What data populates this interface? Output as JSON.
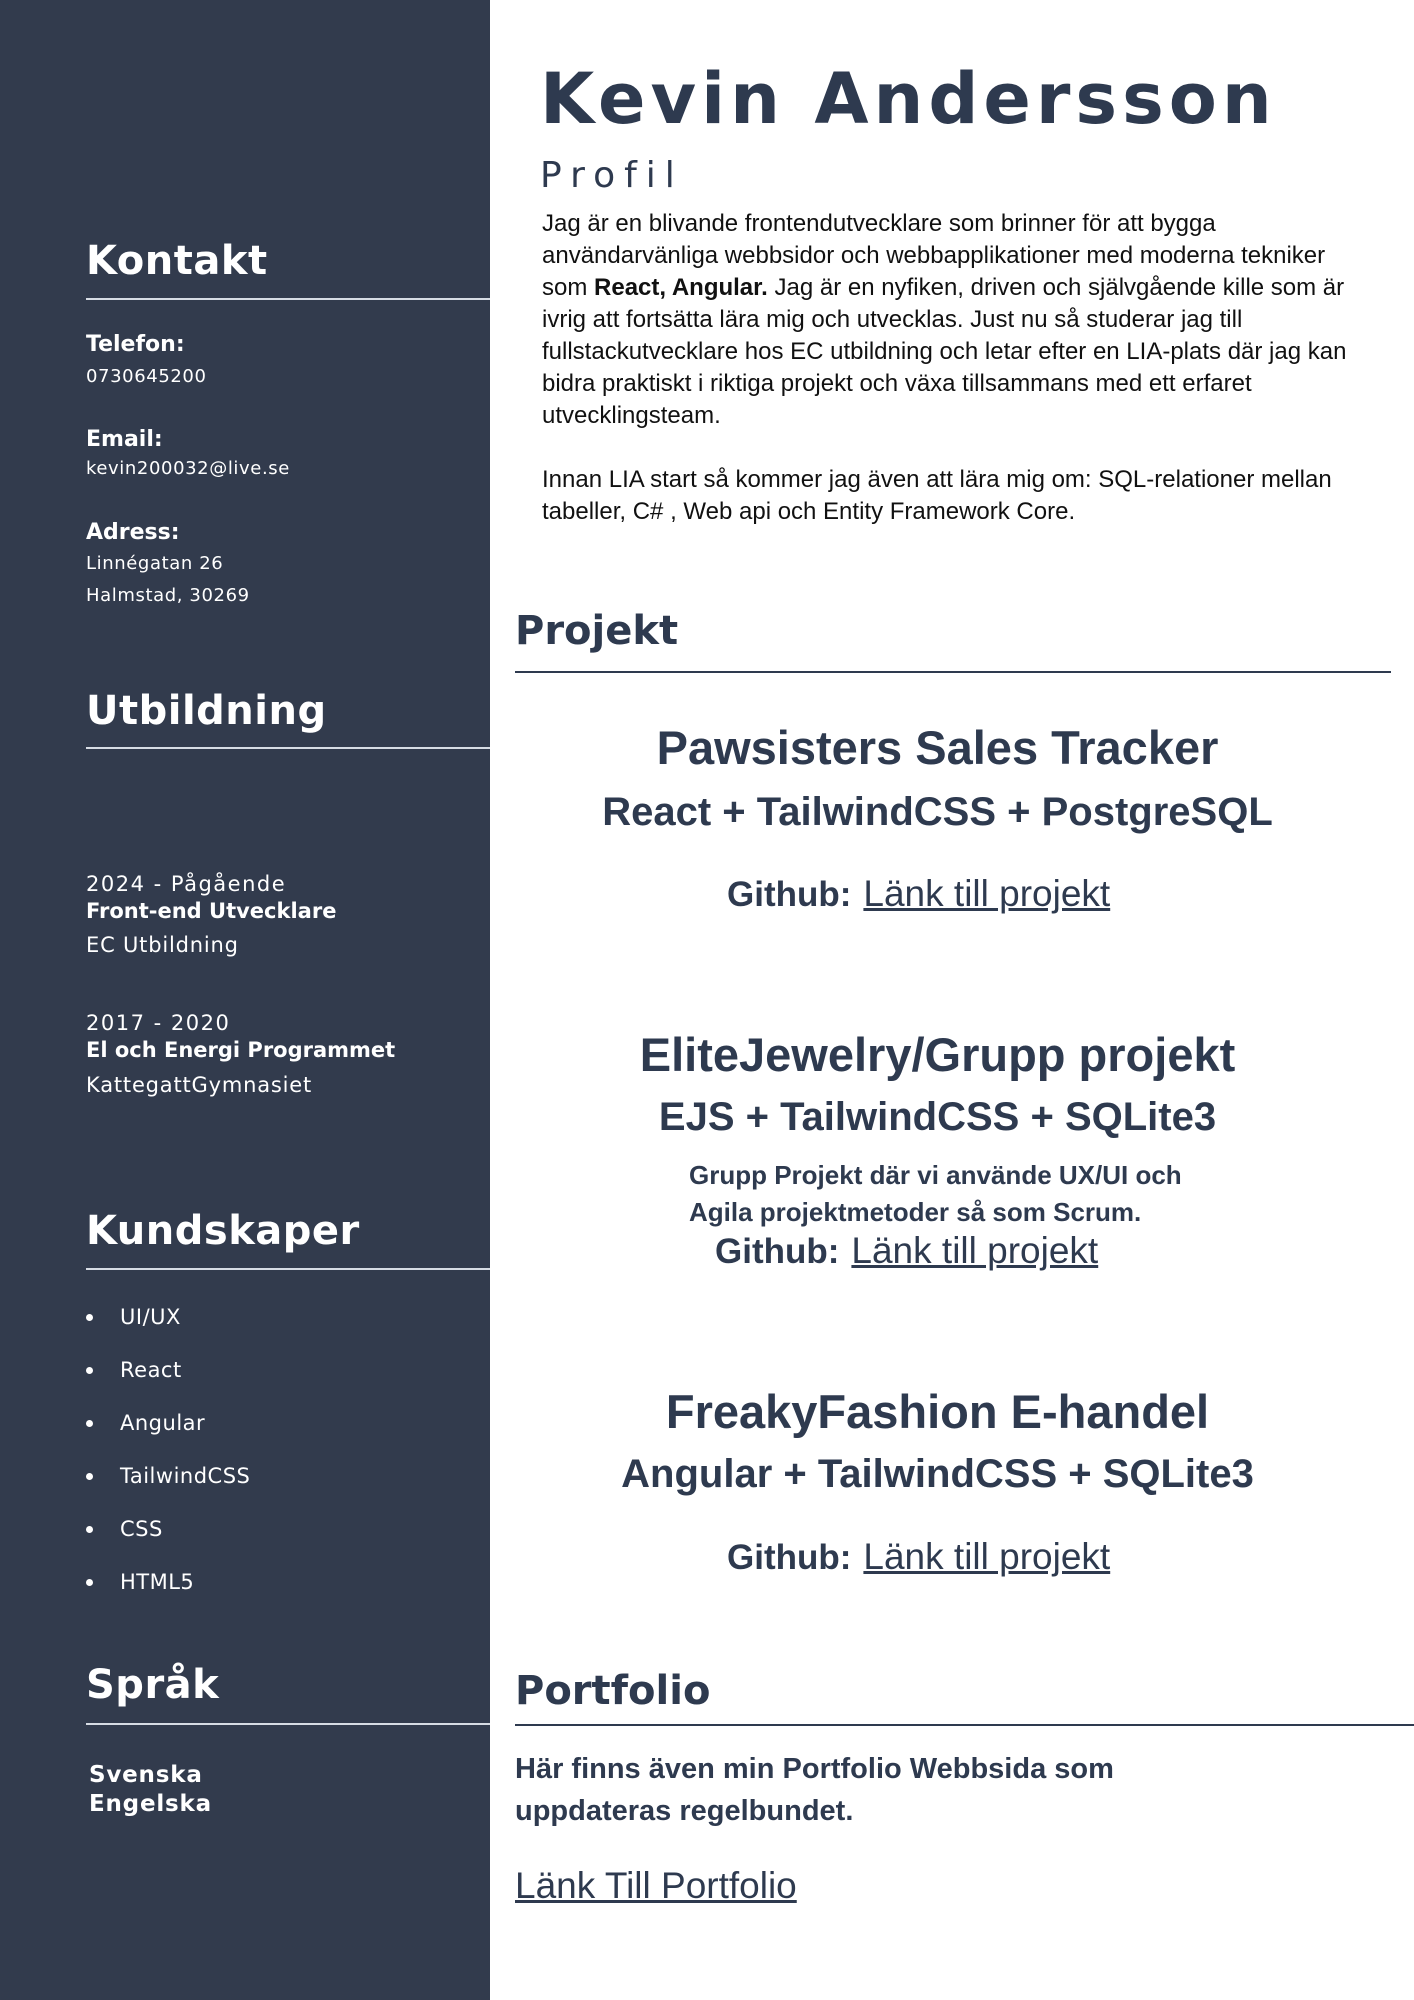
{
  "name": "Kevin Andersson",
  "profile": {
    "heading": "Profil",
    "p1_before": "Jag är en blivande frontendutvecklare som brinner för att bygga användarvänliga webbsidor och webbapplikationer med moderna tekniker som ",
    "p1_bold": "React, Angular.",
    "p1_after": " Jag är en nyfiken, driven och självgående kille som är ivrig att fortsätta lära mig och utvecklas. Just nu så studerar jag till fullstackutvecklare hos EC utbildning och letar efter en LIA-plats där jag kan bidra praktiskt i riktiga projekt och växa tillsammans med ett erfaret utvecklingsteam.",
    "p2": "Innan LIA start så kommer jag även att lära mig om: SQL-relationer mellan tabeller, C# , Web api och Entity Framework Core."
  },
  "contact": {
    "heading": "Kontakt",
    "phone_label": "Telefon:",
    "phone": "0730645200",
    "email_label": "Email:",
    "email": "kevin200032@live.se",
    "address_label": "Adress:",
    "address_line1": "Linnégatan 26",
    "address_line2": "Halmstad, 30269"
  },
  "education": {
    "heading": "Utbildning",
    "items": [
      {
        "years": "2024 - Pågående",
        "title": "Front-end Utvecklare",
        "school": "EC Utbildning"
      },
      {
        "years": "2017 - 2020",
        "title": "El och Energi Programmet",
        "school": "KattegattGymnasiet"
      }
    ]
  },
  "skills": {
    "heading": "Kundskaper",
    "items": [
      "UI/UX",
      "React",
      "Angular",
      "TailwindCSS",
      "CSS",
      "HTML5"
    ]
  },
  "languages": {
    "heading": "Språk",
    "items": [
      "Svenska",
      "Engelska"
    ]
  },
  "projects": {
    "heading": "Projekt",
    "github_label": "Github:",
    "link_text": "Länk till projekt",
    "items": [
      {
        "title": "Pawsisters Sales Tracker",
        "tech": "React + TailwindCSS + PostgreSQL",
        "description": ""
      },
      {
        "title": "EliteJewelry/Grupp projekt",
        "tech": "EJS + TailwindCSS + SQLite3",
        "description": "Grupp Projekt där vi använde UX/UI och Agila projektmetoder så som Scrum."
      },
      {
        "title": "FreakyFashion E-handel",
        "tech": "Angular + TailwindCSS + SQLite3",
        "description": ""
      }
    ]
  },
  "portfolio": {
    "heading": "Portfolio",
    "text": "Här finns även min Portfolio Webbsida som uppdateras regelbundet.",
    "link_text": "Länk Till Portfolio"
  },
  "colors": {
    "sidebar_bg": "#323b4d",
    "text_dark": "#2e3a4f",
    "page_bg": "#ffffff"
  }
}
